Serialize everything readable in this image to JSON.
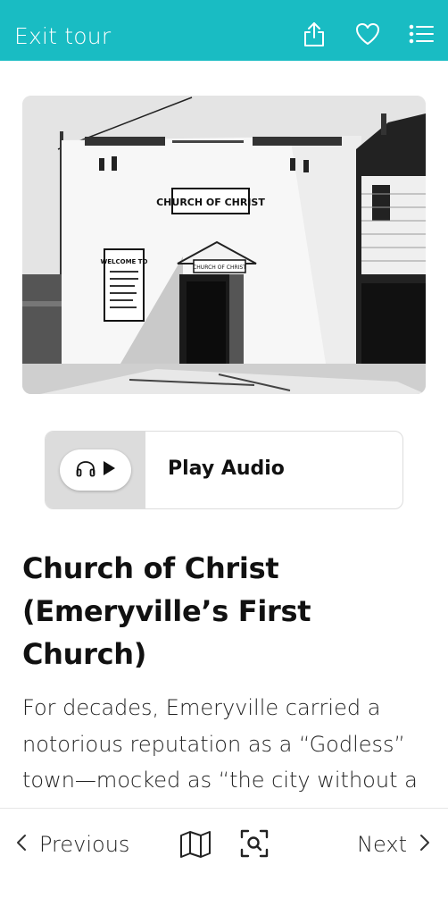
{
  "header": {
    "exit_label": "Exit tour",
    "icons": [
      "share-icon",
      "heart-icon",
      "list-icon"
    ],
    "background": "#19bcc3"
  },
  "hero": {
    "sign_text": "CHURCH OF CHRIST",
    "door_sign": "CHURCH OF CHRIST",
    "welcome_sign": "WELCOME TO"
  },
  "audio": {
    "label": "Play Audio",
    "icons": [
      "headphones-icon",
      "play-icon"
    ]
  },
  "article": {
    "title": "Church of Christ (Emeryville’s First Church)",
    "body": "For decades, Emeryville carried a notorious reputation as a “Godless” town—mocked as “the city without a church,” . . . . . . ”  Unlike"
  },
  "footer": {
    "previous_label": "Previous",
    "next_label": "Next",
    "icons": [
      "chevron-left-icon",
      "map-icon",
      "scan-icon",
      "chevron-right-icon"
    ]
  }
}
